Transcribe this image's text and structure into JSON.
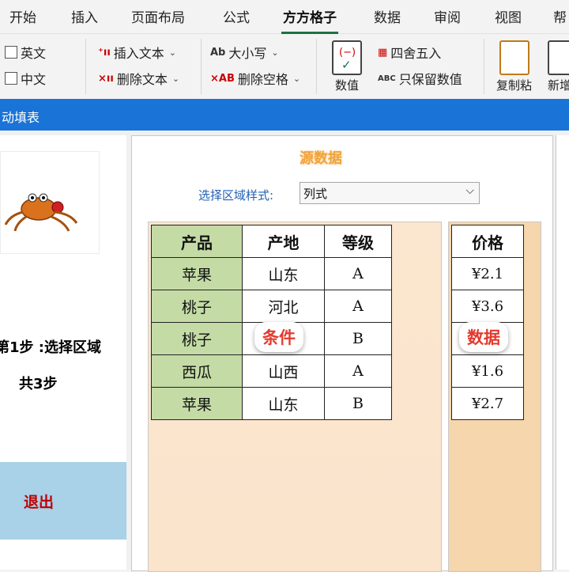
{
  "ribbon": {
    "tabs": [
      "开始",
      "插入",
      "页面布局",
      "公式",
      "方方格子",
      "数据",
      "审阅",
      "视图",
      "帮"
    ],
    "active_tab": "方方格子",
    "checkbox_english": "英文",
    "checkbox_chinese": "中文",
    "insert_text": "插入文本",
    "delete_text": "删除文本",
    "case": "大小写",
    "case_icon": "Ab",
    "delete_spaces": "删除空格",
    "delete_spaces_icon": "×AB",
    "values_button": "数值",
    "round": "四舍五入",
    "keep_values": "只保留数值",
    "keep_values_icon": "ABC",
    "copy_paste": "复制粘",
    "new_add": "新增"
  },
  "dialog": {
    "title": "自动填表",
    "step": "第1步 :选择区域",
    "total_steps": "共3步",
    "exit": "退出",
    "source_title": "源数据",
    "style_label": "选择区域样式:",
    "style_value": "列式",
    "condition_bubble": "条件",
    "data_bubble": "数据"
  },
  "condition_table": {
    "headers": [
      "产品",
      "产地",
      "等级"
    ],
    "rows": [
      [
        "苹果",
        "山东",
        "A"
      ],
      [
        "桃子",
        "河北",
        "A"
      ],
      [
        "桃子",
        "",
        "B"
      ],
      [
        "西瓜",
        "山西",
        "A"
      ],
      [
        "苹果",
        "山东",
        "B"
      ]
    ]
  },
  "price_table": {
    "header": "价格",
    "rows": [
      "¥2.1",
      "¥3.6",
      "",
      "¥1.6",
      "¥2.7"
    ]
  },
  "colors": {
    "title_bar": "#1a73d6",
    "product_column": "#c4dba6",
    "condition_area": "#fbe6cf",
    "data_area": "#f5d6ad",
    "exit_area": "#a9d1e8",
    "accent_tab": "#1e7145"
  }
}
